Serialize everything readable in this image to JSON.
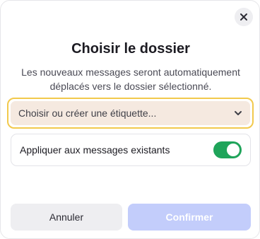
{
  "dialog": {
    "title": "Choisir le dossier",
    "description": "Les nouveaux messages seront automatiquement déplacés vers le dossier sélectionné.",
    "close_icon": "close-icon"
  },
  "folder_select": {
    "placeholder": "Choisir ou créer une étiquette...",
    "icon": "chevron-down-icon"
  },
  "apply_existing": {
    "label": "Appliquer aux messages existants",
    "enabled": true
  },
  "actions": {
    "cancel_label": "Annuler",
    "confirm_label": "Confirmer"
  },
  "colors": {
    "focus_ring": "#f2c94c",
    "select_background": "#f5e9e0",
    "toggle_on": "#1fa45a",
    "confirm_disabled": "#c3cdfb",
    "cancel_background": "#eeeef1"
  }
}
